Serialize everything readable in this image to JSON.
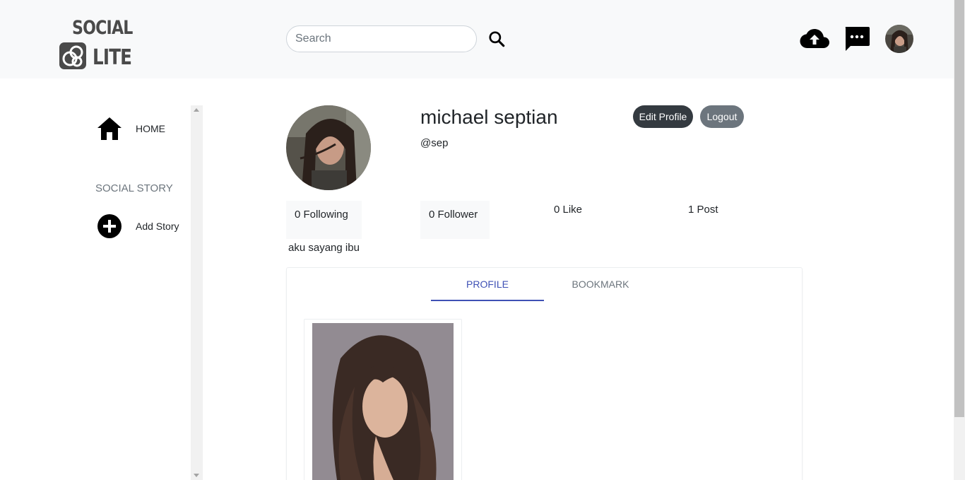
{
  "header": {
    "logo_top": "SOCIAL",
    "logo_bottom": "LITE",
    "search_placeholder": "Search",
    "search_value": ""
  },
  "sidebar": {
    "items": [
      {
        "label": "HOME",
        "icon": "home-icon"
      },
      {
        "label": "Add Story",
        "icon": "plus-circle-icon"
      }
    ],
    "section_title": "SOCIAL STORY"
  },
  "profile": {
    "name": "michael septian",
    "handle": "@sep",
    "edit_label": "Edit Profile",
    "logout_label": "Logout",
    "stats": {
      "following": "0 Following",
      "follower": "0 Follower",
      "like": "0 Like",
      "post": "1 Post"
    },
    "bio": "aku sayang ibu"
  },
  "tabs": [
    {
      "label": "PROFILE",
      "active": true
    },
    {
      "label": "BOOKMARK",
      "active": false
    }
  ],
  "colors": {
    "header_bg": "#f8f9fa",
    "accent": "#3f51b5",
    "edit_button": "#343a40",
    "logout_button": "#6c757d"
  }
}
